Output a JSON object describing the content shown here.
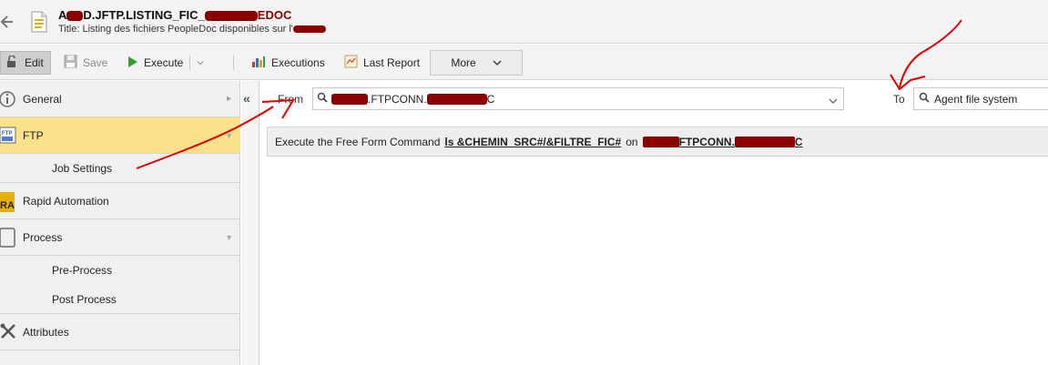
{
  "header": {
    "title_prefix": "A",
    "title_middle": "D.JFTP.LISTING_FIC_",
    "title_suffix": "EDOC",
    "subtitle": "Title: Listing des fichiers PeopleDoc disponibles sur l'"
  },
  "toolbar": {
    "edit_label": "Edit",
    "save_label": "Save",
    "execute_label": "Execute",
    "executions_label": "Executions",
    "last_report_label": "Last Report",
    "more_label": "More"
  },
  "sidebar": {
    "items": [
      {
        "label": "General"
      },
      {
        "label": "FTP"
      },
      {
        "label": "Job Settings"
      },
      {
        "label": "Rapid Automation"
      },
      {
        "label": "Process"
      },
      {
        "label": "Pre-Process"
      },
      {
        "label": "Post Process"
      },
      {
        "label": "Attributes"
      }
    ]
  },
  "main": {
    "from_label": "From",
    "from_value": ".FTPCONN.",
    "from_value_tail": "C",
    "to_label": "To",
    "to_value": "Agent file system",
    "command": {
      "prefix": "Execute the Free Form Command",
      "cmd": "ls &CHEMIN_SRC#/&FILTRE_FIC#",
      "on": "on",
      "target": "FTPCONN.",
      "target_tail": "C"
    }
  },
  "colors": {
    "selected_nav": "#fbe18a",
    "redaction": "#8b0000",
    "annotation": "#e00000"
  },
  "icons": [
    "back-arrow-icon",
    "document-icon",
    "edit-icon",
    "save-icon",
    "play-icon",
    "executions-chart-icon",
    "report-icon",
    "info-icon",
    "ftp-icon",
    "ra-icon",
    "process-icon",
    "attributes-icon",
    "search-icon",
    "chevron-down-icon"
  ]
}
